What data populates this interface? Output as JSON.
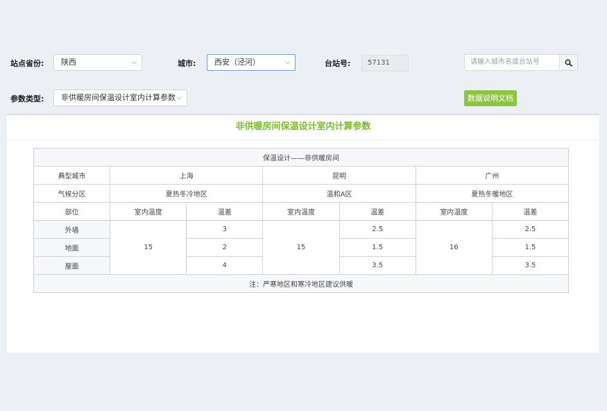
{
  "filters": {
    "province_label": "站点省份:",
    "province_value": "陕西",
    "city_label": "城市:",
    "city_value": "西安（泾河）",
    "station_label": "台站号:",
    "station_value": "57131",
    "search_placeholder": "请输入城市名或台站号",
    "param_label": "参数类型:",
    "param_value": "非供暖房间保温设计室内计算参数",
    "doc_button": "数据说明文档"
  },
  "panel": {
    "title": "非供暖房间保温设计室内计算参数"
  },
  "table": {
    "caption": "保温设计——非供暖房间",
    "city_header": "典型城市",
    "cities": [
      "上海",
      "昆明",
      "广州"
    ],
    "zone_header": "气候分区",
    "zones": [
      "夏热冬冷地区",
      "温和A区",
      "夏热冬暖地区"
    ],
    "part_header": "部位",
    "indoor_temp_header": "室内温度",
    "temp_diff_header": "温差",
    "parts": [
      "外墙",
      "地面",
      "屋面"
    ],
    "indoor_temps": [
      "15",
      "15",
      "16"
    ],
    "temp_diffs": [
      [
        "3",
        "2",
        "4"
      ],
      [
        "2.5",
        "1.5",
        "3.5"
      ],
      [
        "2.5",
        "1.5",
        "3.5"
      ]
    ],
    "note": "注：严寒地区和寒冷地区建议供暖"
  },
  "icons": {
    "search": "search-icon",
    "dropdown": "chevron-down-icon"
  },
  "colors": {
    "accent_green": "#8cc53f",
    "title_green": "#7dbb2e",
    "background": "#eceff4"
  }
}
